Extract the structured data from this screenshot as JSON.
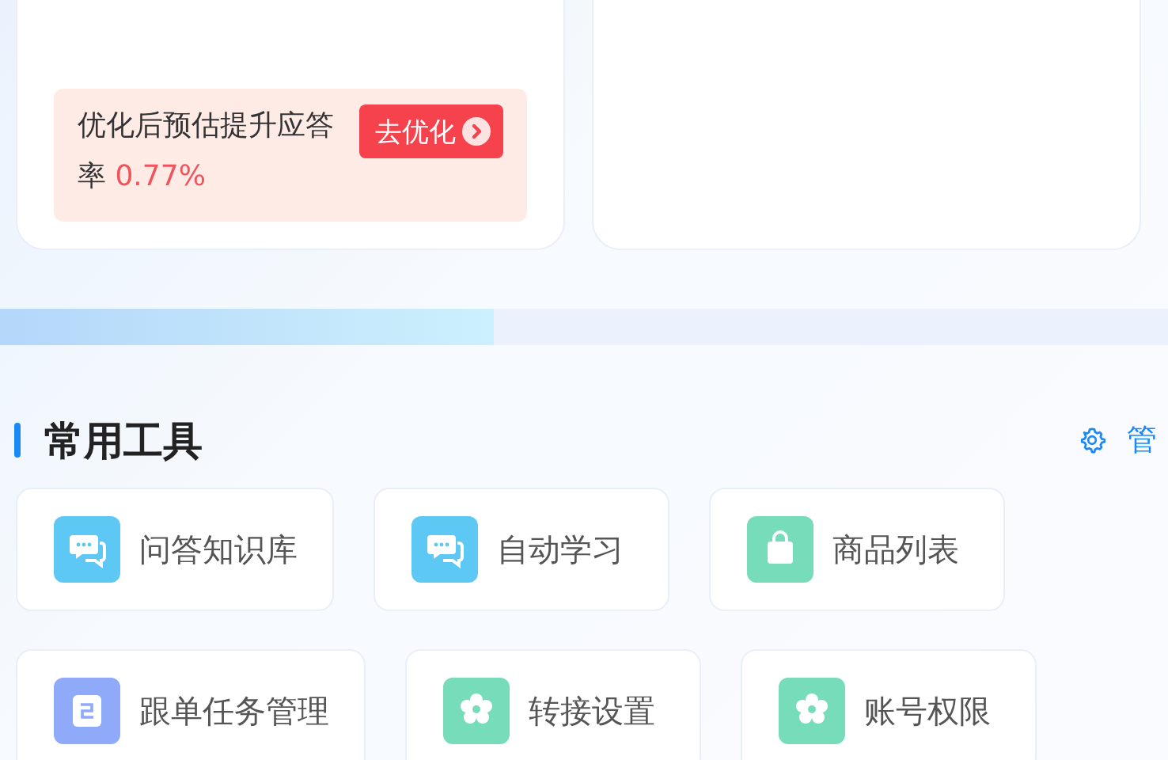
{
  "optimize_tip": {
    "text": "优化后预估提升应答率",
    "value": "0.77%",
    "button": "去优化"
  },
  "section": {
    "title": "常用工具",
    "manage_link": "管"
  },
  "tool_rows": [
    [
      {
        "label": "问答知识库",
        "kind": "chat",
        "color": "#5ec8f5"
      },
      {
        "label": "自动学习",
        "kind": "chat",
        "color": "#5ec8f5"
      },
      {
        "label": "商品列表",
        "kind": "bag",
        "color": "#76dcb9"
      }
    ],
    [
      {
        "label": "跟单任务管理",
        "kind": "task",
        "color": "#8eaaf8"
      },
      {
        "label": "转接设置",
        "kind": "gear",
        "color": "#76dcb9"
      },
      {
        "label": "账号权限",
        "kind": "gear",
        "color": "#76dcb9"
      }
    ]
  ]
}
